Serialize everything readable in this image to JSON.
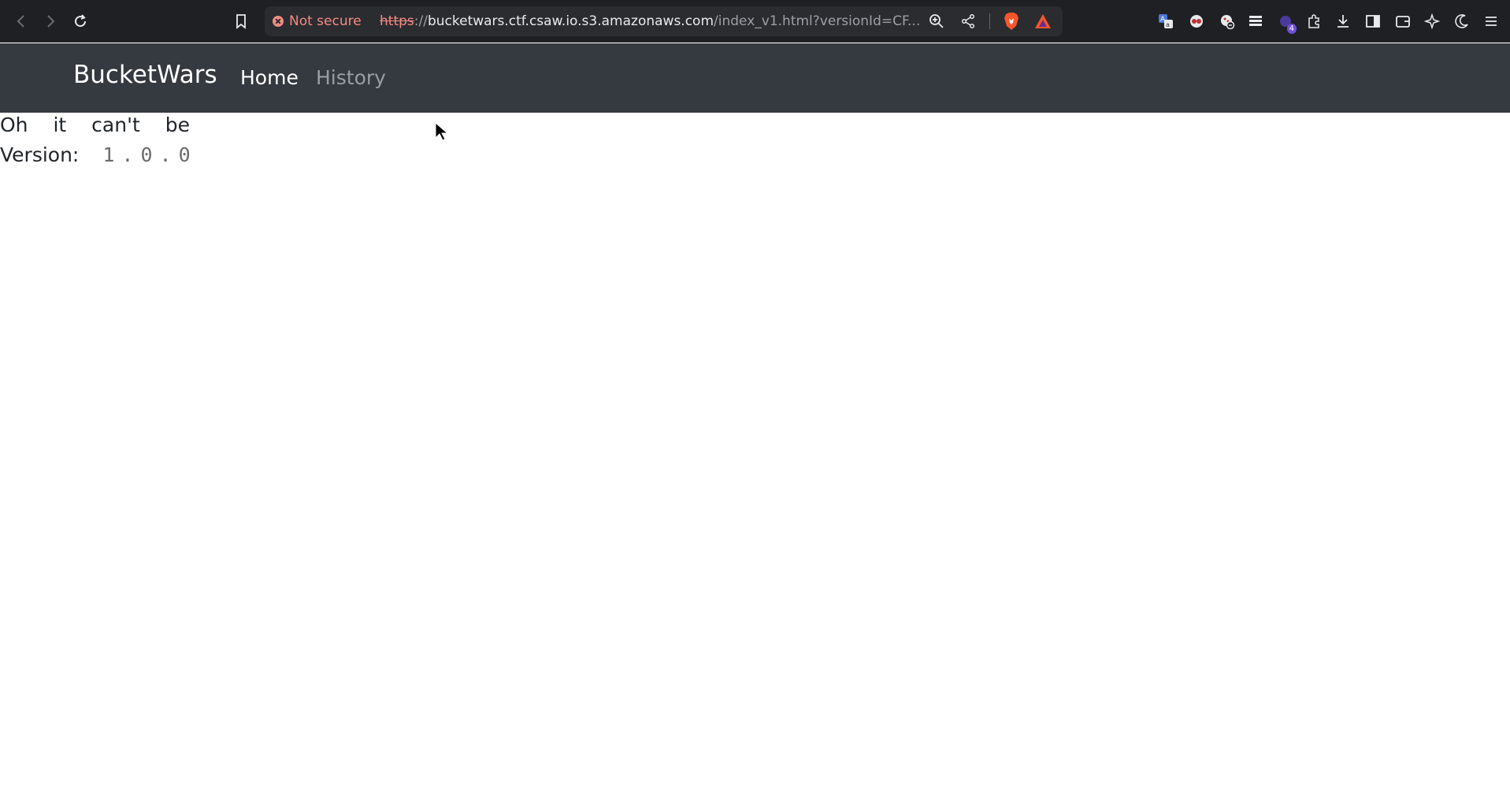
{
  "browser": {
    "security_label": "Not secure",
    "url_scheme": "https",
    "url_sep": "://",
    "url_host": "bucketwars.ctf.csaw.io.s3.amazonaws.com",
    "url_path": "/index_v1.html?versionId=CF...",
    "extension_badge": "4"
  },
  "navbar": {
    "brand": "BucketWars",
    "home": "Home",
    "history": "History"
  },
  "content": {
    "message": "Oh it can't be",
    "version_label": "Version:",
    "version_value": "1.0.0"
  },
  "colors": {
    "navbar_bg": "#343a40",
    "not_secure": "#f28b82"
  }
}
